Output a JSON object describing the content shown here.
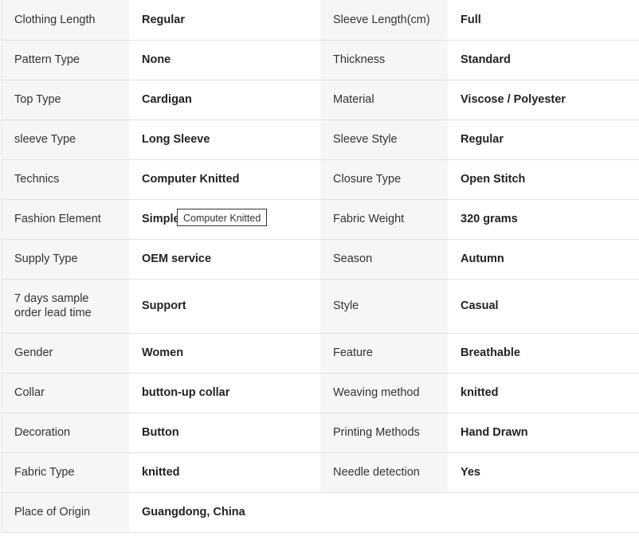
{
  "rows": [
    {
      "k1": "Clothing Length",
      "v1": "Regular",
      "k2": "Sleeve Length(cm)",
      "v2": "Full"
    },
    {
      "k1": "Pattern Type",
      "v1": "None",
      "k2": "Thickness",
      "v2": "Standard"
    },
    {
      "k1": "Top Type",
      "v1": "Cardigan",
      "k2": "Material",
      "v2": "Viscose / Polyester"
    },
    {
      "k1": "sleeve Type",
      "v1": "Long Sleeve",
      "k2": "Sleeve Style",
      "v2": "Regular"
    },
    {
      "k1": "Technics",
      "v1": "Computer Knitted",
      "k2": "Closure Type",
      "v2": "Open Stitch"
    },
    {
      "k1": "Fashion Element",
      "v1": "Simple",
      "k2": "Fabric Weight",
      "v2": "320 grams"
    },
    {
      "k1": "Supply Type",
      "v1": "OEM service",
      "k2": "Season",
      "v2": "Autumn"
    },
    {
      "k1": "7 days sample order lead time",
      "v1": "Support",
      "k2": "Style",
      "v2": "Casual"
    },
    {
      "k1": "Gender",
      "v1": "Women",
      "k2": "Feature",
      "v2": "Breathable"
    },
    {
      "k1": "Collar",
      "v1": "button-up collar",
      "k2": "Weaving method",
      "v2": "knitted"
    },
    {
      "k1": "Decoration",
      "v1": "Button",
      "k2": "Printing Methods",
      "v2": "Hand Drawn"
    },
    {
      "k1": "Fabric Type",
      "v1": "knitted",
      "k2": "Needle detection",
      "v2": "Yes"
    },
    {
      "k1": "Place of Origin",
      "v1": "Guangdong, China"
    }
  ],
  "tooltip": {
    "text": "Computer Knitted"
  }
}
